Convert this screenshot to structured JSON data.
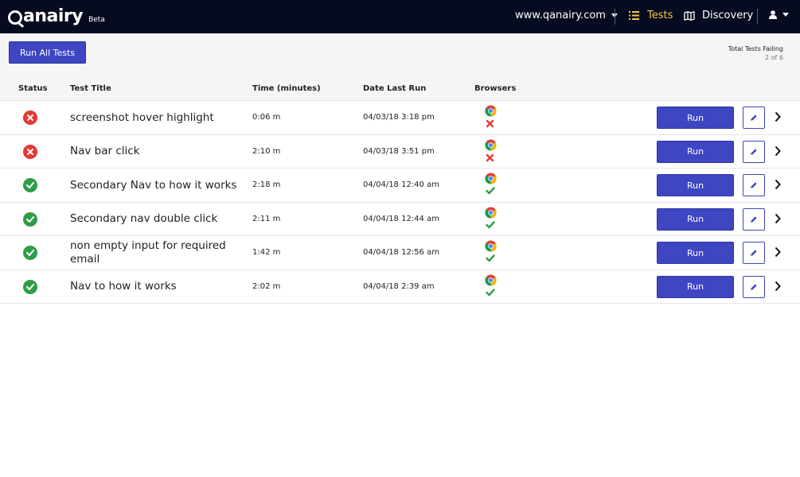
{
  "brand": {
    "name": "anairy",
    "badge": "Beta"
  },
  "nav": {
    "domain": "www.qanairy.com",
    "tests_label": "Tests",
    "discovery_label": "Discovery"
  },
  "toolbar": {
    "run_all_label": "Run All Tests",
    "failing_label": "Total Tests Failing",
    "failing_count": "2 of 6"
  },
  "table": {
    "headers": {
      "status": "Status",
      "title": "Test Title",
      "time": "Time (minutes)",
      "date": "Date Last Run",
      "browsers": "Browsers"
    },
    "rows": [
      {
        "status": "failing",
        "title": "screenshot hover highlight",
        "time": "0:06 m",
        "date": "04/03/18 3:18 pm",
        "browser": "chrome",
        "browser_result": "failed",
        "run_label": "Run"
      },
      {
        "status": "failing",
        "title": "Nav bar click",
        "time": "2:10 m",
        "date": "04/03/18 3:51 pm",
        "browser": "chrome",
        "browser_result": "failed",
        "run_label": "Run"
      },
      {
        "status": "passing",
        "title": "Secondary Nav to how it works",
        "time": "2:18 m",
        "date": "04/04/18 12:40 am",
        "browser": "chrome",
        "browser_result": "passed",
        "run_label": "Run"
      },
      {
        "status": "passing",
        "title": "Secondary nav double click",
        "time": "2:11 m",
        "date": "04/04/18 12:44 am",
        "browser": "chrome",
        "browser_result": "passed",
        "run_label": "Run"
      },
      {
        "status": "passing",
        "title": "non empty input for required email",
        "time": "1:42 m",
        "date": "04/04/18 12:56 am",
        "browser": "chrome",
        "browser_result": "passed",
        "run_label": "Run"
      },
      {
        "status": "passing",
        "title": "Nav to how it works",
        "time": "2:02 m",
        "date": "04/04/18 2:39 am",
        "browser": "chrome",
        "browser_result": "passed",
        "run_label": "Run"
      }
    ]
  },
  "icons": {
    "failing": "x-circle-icon",
    "passing": "check-circle-icon",
    "chrome": "chrome-icon",
    "edit": "pencil-icon",
    "expand": "chevron-right-icon"
  },
  "colors": {
    "navbar": "#060b1f",
    "accent": "#3f46c2",
    "active_nav": "#f2c94c",
    "fail": "#e53935",
    "pass": "#2e9e46"
  }
}
